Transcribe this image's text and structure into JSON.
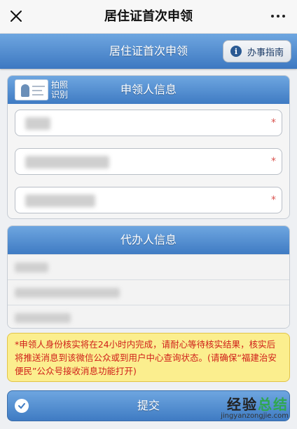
{
  "topbar": {
    "title": "居住证首次申领"
  },
  "page": {
    "title": "居住证首次申领",
    "guide_label": "办事指南",
    "info_glyph": "i"
  },
  "applicant": {
    "header": "申领人信息",
    "photo_label_line1": "拍照",
    "photo_label_line2": "识别",
    "required_mark": "*"
  },
  "agent": {
    "header": "代办人信息"
  },
  "notice": "*申领人身份核实将在24小时内完成，请耐心等待核实结果，核实后将推送消息到该微信公众或到用户中心查询状态。(请确保“福建治安便民”公众号接收消息功能打开)",
  "submit_label": "提交",
  "watermark": {
    "title_part1": "经验",
    "title_part2": "总结",
    "url": "jingyanzongjie.com"
  },
  "colors": {
    "header_blue": "#3f7bc3",
    "notice_bg": "#fbee8e",
    "notice_text": "#d0201a",
    "required_star": "#d9534f"
  }
}
